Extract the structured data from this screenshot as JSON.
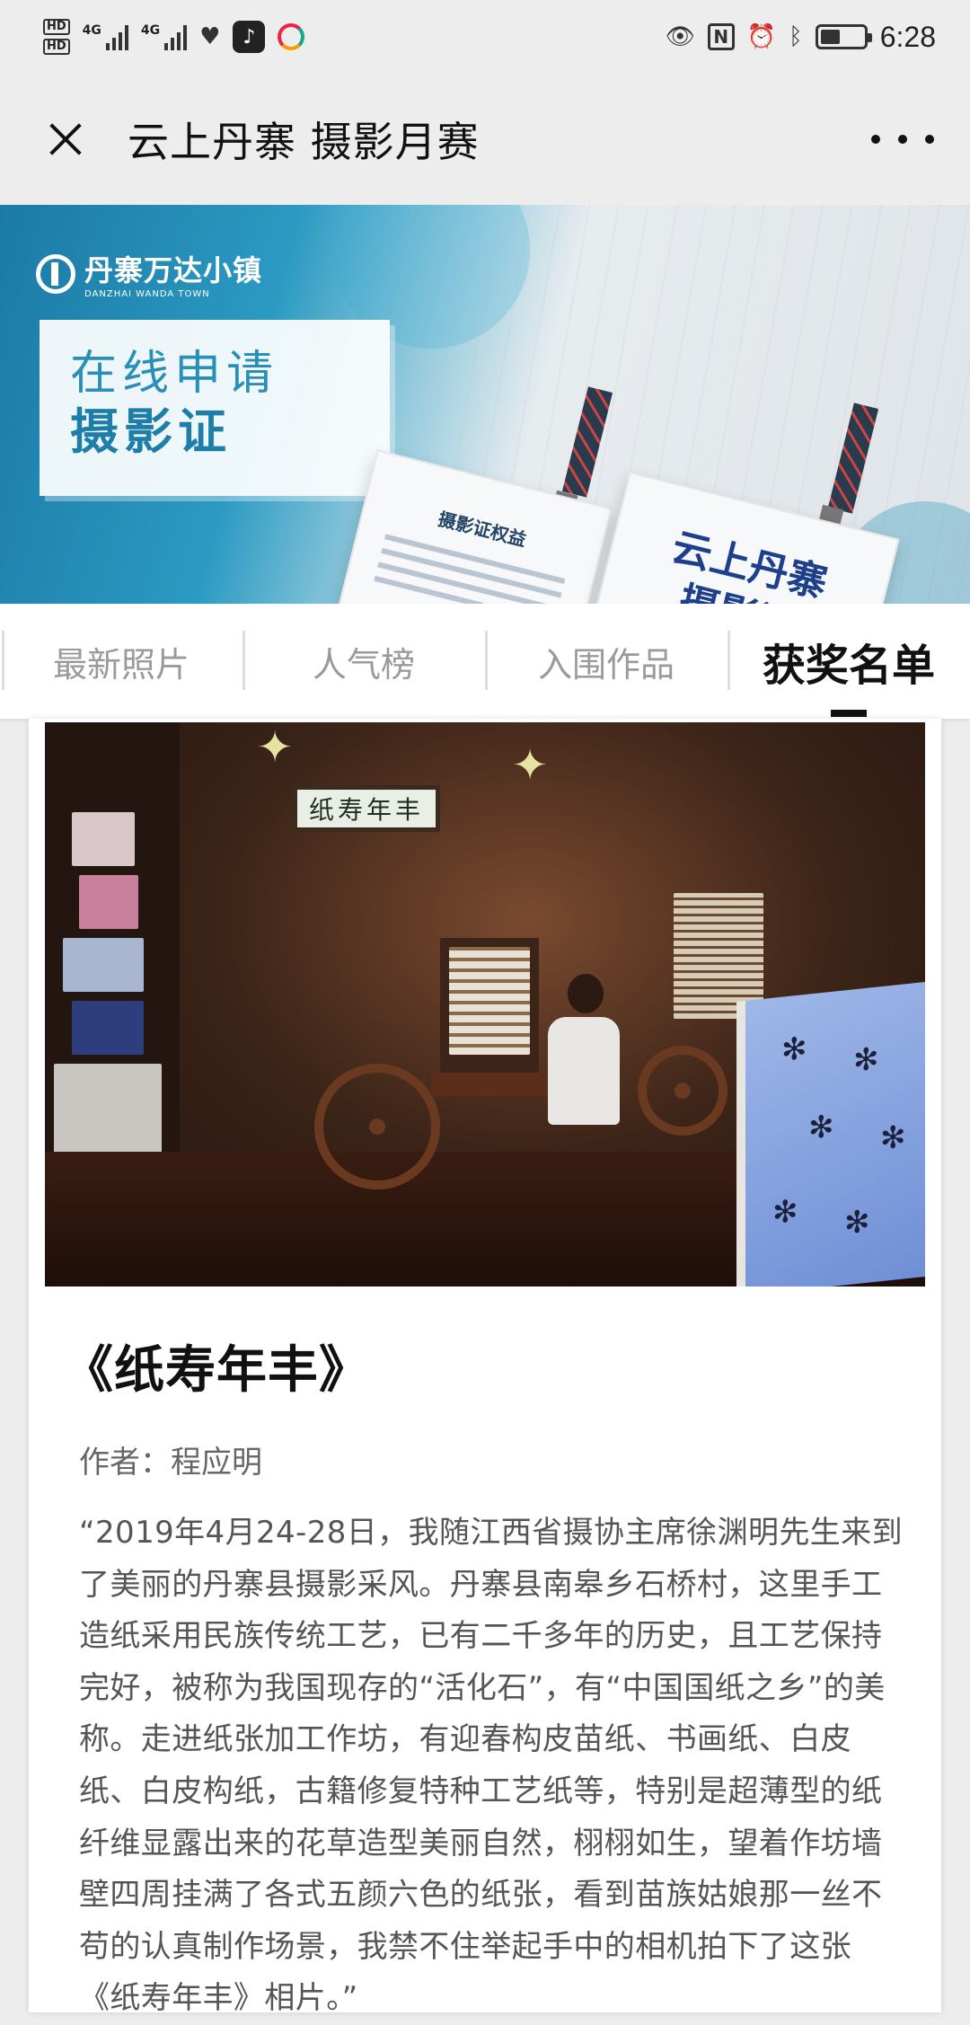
{
  "status_bar": {
    "hd_labels": [
      "HD",
      "HD"
    ],
    "network_labels": [
      "4G",
      "4G"
    ],
    "icons": [
      "hd-icon",
      "signal-icon",
      "signal-icon",
      "health-icon",
      "tiktok-icon",
      "browser-icon",
      "eye-icon",
      "nfc-icon",
      "alarm-icon",
      "bluetooth-icon",
      "battery-icon"
    ],
    "battery_level": 0.45,
    "time": "6:28"
  },
  "titlebar": {
    "title": "云上丹寨 摄影月赛",
    "close_icon": "close-icon",
    "more_icon": "more-icon"
  },
  "banner": {
    "logo_cn": "丹寨万达小镇",
    "logo_en": "DANZHAI WANDA TOWN",
    "apply_line1": "在线申请",
    "apply_line2": "摄影证",
    "card_a_title": "摄影证权益",
    "card_b_title": "云上丹寨\n摄影证"
  },
  "tabs": [
    {
      "label": "最新照片",
      "active": false
    },
    {
      "label": "人气榜",
      "active": false
    },
    {
      "label": "入围作品",
      "active": false
    },
    {
      "label": "获奖名单",
      "active": true
    }
  ],
  "entry": {
    "photo_sign_text": "纸寿年丰",
    "title": "《纸寿年丰》",
    "author": "作者：程应明",
    "description": "“2019年4月24-28日，我随江西省摄协主席徐渊明先生来到了美丽的丹寨县摄影采风。丹寨县南皋乡石桥村，这里手工造纸采用民族传统工艺，已有二千多年的历史，且工艺保持完好，被称为我国现存的“活化石”，有“中国国纸之乡”的美称。走进纸张加工作坊，有迎春构皮苗纸、书画纸、白皮纸、白皮构纸，古籍修复特种工艺纸等，特别是超薄型的纸纤维显露出来的花草造型美丽自然，栩栩如生，望着作坊墙壁四周挂满了各式五颜六色的纸张，看到苗族姑娘那一丝不苟的认真制作场景，我禁不住举起手中的相机拍下了这张《纸寿年丰》相片。”"
  }
}
